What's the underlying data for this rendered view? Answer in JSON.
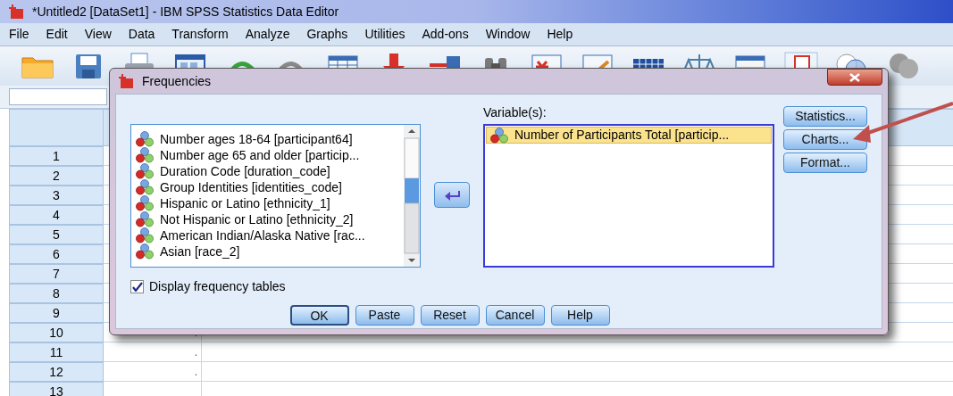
{
  "app": {
    "title": "*Untitled2 [DataSet1] - IBM SPSS Statistics Data Editor",
    "menu": [
      "File",
      "Edit",
      "View",
      "Data",
      "Transform",
      "Analyze",
      "Graphs",
      "Utilities",
      "Add-ons",
      "Window",
      "Help"
    ]
  },
  "grid": {
    "rows": [
      {
        "number": "1"
      },
      {
        "number": "2"
      },
      {
        "number": "3"
      },
      {
        "number": "4"
      },
      {
        "number": "5"
      },
      {
        "number": "6"
      },
      {
        "number": "7"
      },
      {
        "number": "8"
      },
      {
        "number": "9"
      },
      {
        "number": "10",
        "column_1": "."
      },
      {
        "number": "11",
        "column_1": "."
      },
      {
        "number": "12",
        "column_1": "."
      },
      {
        "number": "13"
      }
    ]
  },
  "dialog": {
    "title": "Frequencies",
    "source_list": {
      "items": [
        {
          "text": "Number ages 18-64 [participant64]",
          "selected": false
        },
        {
          "text": "Number age 65 and older [particip...",
          "selected": false
        },
        {
          "text": "Duration Code [duration_code]",
          "selected": false
        },
        {
          "text": "Group Identities [identities_code]",
          "selected": false
        },
        {
          "text": "Hispanic or Latino [ethnicity_1]",
          "selected": false
        },
        {
          "text": "Not Hispanic or Latino [ethnicity_2]",
          "selected": false
        },
        {
          "text": "American Indian/Alaska Native [rac...",
          "selected": false
        },
        {
          "text": "Asian [race_2]",
          "selected": false
        }
      ]
    },
    "target": {
      "label": "Variable(s):",
      "items": [
        {
          "text": "Number of Participants Total [particip...",
          "selected": true
        }
      ]
    },
    "side_buttons": [
      "Statistics...",
      "Charts...",
      "Format..."
    ],
    "display_frequency_tables": {
      "label": "Display frequency tables",
      "checked": true
    },
    "buttons": [
      {
        "label": "OK",
        "default": true
      },
      {
        "label": "Paste",
        "default": false
      },
      {
        "label": "Reset",
        "default": false
      },
      {
        "label": "Cancel",
        "default": false
      },
      {
        "label": "Help",
        "default": false
      }
    ]
  }
}
